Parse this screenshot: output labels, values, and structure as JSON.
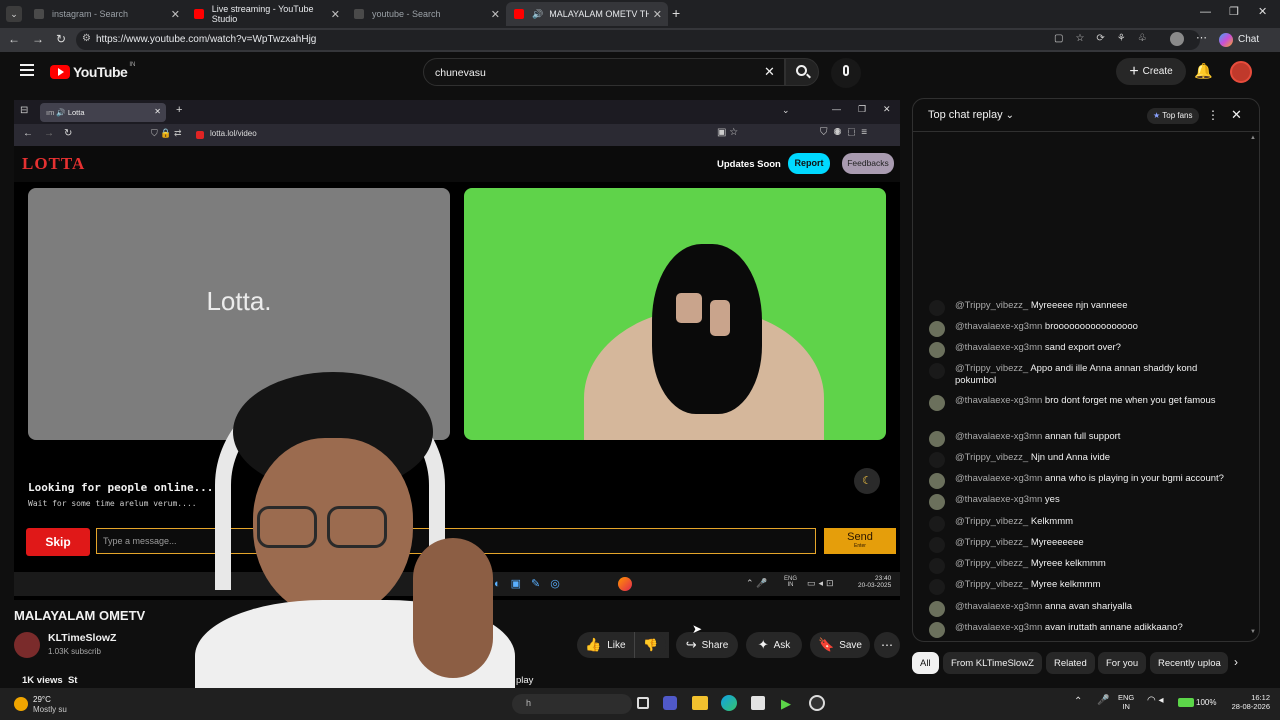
{
  "browser": {
    "tabs": [
      {
        "label": "instagram - Search",
        "fav": "#4a4a4a"
      },
      {
        "label": "Live streaming - YouTube Studio",
        "fav": "#ff0000"
      },
      {
        "label": "youtube - Search",
        "fav": "#4a4a4a"
      },
      {
        "label": "MALAYALAM OMETV THE NE",
        "fav": "#ff0000"
      }
    ],
    "url": "https://www.youtube.com/watch?v=WpTwzxahHjg",
    "chat_label": "Chat"
  },
  "youtube": {
    "logo": "YouTube",
    "region": "IN",
    "search_value": "chunevasu",
    "create_label": "Create"
  },
  "embedded": {
    "tab_label": "Lotta",
    "url": "lotta.lol/video",
    "brand": "LOTTA",
    "updates": "Updates Soon",
    "report": "Report",
    "feedbacks": "Feedbacks",
    "placeholder_logo": "Lotta.",
    "looking": "Looking for people online...",
    "wait": "Wait for some time arelum verum....",
    "skip": "Skip",
    "message_placeholder": "Type a message...",
    "send": "Send",
    "send_hint": "Enter",
    "tray_lang": "ENG",
    "tray_region": "IN",
    "tray_time": "23:40",
    "tray_date": "20-03-2025"
  },
  "video": {
    "title": "MALAYALAM OMETV",
    "channel": "KLTimeSlowZ",
    "subscribers": "1.03K subscrib",
    "views": "1K views  St",
    "replay": "play",
    "like": "Like",
    "share": "Share",
    "ask": "Ask",
    "save": "Save"
  },
  "chat": {
    "header": "Top chat replay",
    "top_fans": "Top fans",
    "messages": [
      {
        "author": "@Trippy_vibezz_",
        "text": "Myreeeee njn vanneee",
        "av": "#1a1a1a"
      },
      {
        "author": "@thavalaexe-xg3mn",
        "text": "broooooooooooooooo",
        "av": "#6b705c"
      },
      {
        "author": "@thavalaexe-xg3mn",
        "text": "sand export over?",
        "av": "#6b705c"
      },
      {
        "author": "@Trippy_vibezz_",
        "text": "Appo andi ille Anna annan shaddy kond pokumbol",
        "av": "#1a1a1a"
      },
      {
        "author": "@thavalaexe-xg3mn",
        "text": "bro dont forget me when you get famous",
        "av": "#6b705c"
      },
      {
        "author": "@thavalaexe-xg3mn",
        "text": "annan full support",
        "av": "#6b705c"
      },
      {
        "author": "@Trippy_vibezz_",
        "text": "Njn und Anna ivide",
        "av": "#1a1a1a"
      },
      {
        "author": "@thavalaexe-xg3mn",
        "text": "anna who is playing in your bgmi account?",
        "av": "#6b705c"
      },
      {
        "author": "@thavalaexe-xg3mn",
        "text": "yes",
        "av": "#6b705c"
      },
      {
        "author": "@Trippy_vibezz_",
        "text": "Kelkmmm",
        "av": "#1a1a1a"
      },
      {
        "author": "@Trippy_vibezz_",
        "text": "Myreeeeeee",
        "av": "#1a1a1a"
      },
      {
        "author": "@Trippy_vibezz_",
        "text": "Myreee kelkmmm",
        "av": "#1a1a1a"
      },
      {
        "author": "@Trippy_vibezz_",
        "text": "Myree kelkmmm",
        "av": "#1a1a1a"
      },
      {
        "author": "@thavalaexe-xg3mn",
        "text": "anna avan shariyalla",
        "av": "#6b705c"
      },
      {
        "author": "@thavalaexe-xg3mn",
        "text": "avan iruttath annane adikkaano?",
        "av": "#6b705c"
      }
    ]
  },
  "chips": [
    "All",
    "From KLTimeSlowZ",
    "Related",
    "For you",
    "Recently uploa"
  ],
  "taskbar": {
    "temp": "29°C",
    "weather": "Mostly su",
    "search_hint": "h",
    "lang": "ENG",
    "region": "IN",
    "battery": "100%",
    "time": "16:12",
    "date": "28-08-2026"
  },
  "colors": {
    "yt_red": "#ff0000",
    "report": "#00d9ff",
    "send": "#e59e0b",
    "skip": "#e01818"
  }
}
